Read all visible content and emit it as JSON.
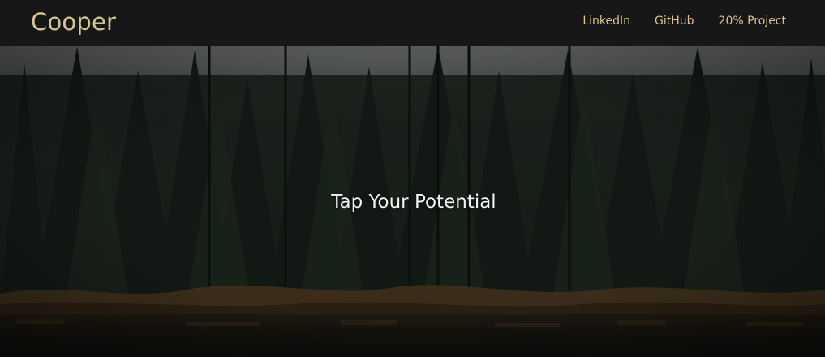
{
  "navbar": {
    "brand": "Cooper",
    "links": [
      {
        "label": "LinkedIn"
      },
      {
        "label": "GitHub"
      },
      {
        "label": "20% Project"
      }
    ]
  },
  "hero": {
    "title": "Tap Your Potential",
    "background": "forest-lake-photo"
  },
  "colors": {
    "navbar_bg": "#171717",
    "accent": "#d8c48e",
    "hero_text": "#f4f4f4"
  }
}
